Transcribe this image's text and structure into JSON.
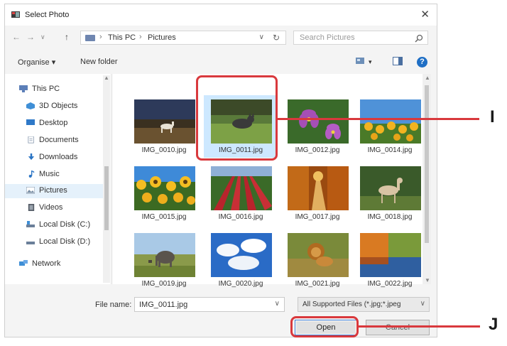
{
  "window": {
    "title": "Select Photo",
    "close_glyph": "✕"
  },
  "nav": {
    "back_glyph": "←",
    "forward_glyph": "→",
    "up_glyph": "↑",
    "address_segments": [
      "This PC",
      "Pictures"
    ],
    "separator_glyph": "›",
    "dropdown_glyph": "∨",
    "refresh_glyph": "↻",
    "search_placeholder": "Search Pictures",
    "search_glyph": "⌕"
  },
  "toolbar": {
    "organise_label": "Organise ▾",
    "new_folder_label": "New folder",
    "view_dd_glyph": "▾",
    "help_glyph": "?"
  },
  "sidebar": {
    "items": [
      {
        "label": "This PC",
        "icon": "pc-icon",
        "color": "#5c7fb8"
      },
      {
        "label": "3D Objects",
        "icon": "cube-icon",
        "color": "#3f8fd6"
      },
      {
        "label": "Desktop",
        "icon": "desktop-icon",
        "color": "#2f79c8"
      },
      {
        "label": "Documents",
        "icon": "document-icon",
        "color": "#8a9bb0"
      },
      {
        "label": "Downloads",
        "icon": "download-icon",
        "color": "#2a74c4"
      },
      {
        "label": "Music",
        "icon": "music-icon",
        "color": "#2a74c4"
      },
      {
        "label": "Pictures",
        "icon": "pictures-icon",
        "color": "#7a8fa6"
      },
      {
        "label": "Videos",
        "icon": "video-icon",
        "color": "#555c66"
      },
      {
        "label": "Local Disk (C:)",
        "icon": "disk-icon",
        "color": "#6b7f99"
      },
      {
        "label": "Local Disk (D:)",
        "icon": "disk-icon",
        "color": "#6b7f99"
      },
      {
        "label": "Network",
        "icon": "network-icon",
        "color": "#3f8fd6"
      }
    ],
    "selected_label": "Pictures"
  },
  "files": [
    {
      "name": "IMG_0010.jpg",
      "subject": "horse-on-dark-field",
      "selected": false
    },
    {
      "name": "IMG_0011.jpg",
      "subject": "cat-on-grass",
      "selected": true
    },
    {
      "name": "IMG_0012.jpg",
      "subject": "purple-flowers",
      "selected": false
    },
    {
      "name": "IMG_0014.jpg",
      "subject": "sunflowers-blue-sky",
      "selected": false
    },
    {
      "name": "IMG_0015.jpg",
      "subject": "sunflower-field",
      "selected": false
    },
    {
      "name": "IMG_0016.jpg",
      "subject": "tulip-rows",
      "selected": false
    },
    {
      "name": "IMG_0017.jpg",
      "subject": "autumn-path",
      "selected": false
    },
    {
      "name": "IMG_0018.jpg",
      "subject": "deer",
      "selected": false
    },
    {
      "name": "IMG_0019.jpg",
      "subject": "elephant-savanna",
      "selected": false
    },
    {
      "name": "IMG_0020.jpg",
      "subject": "clouds-sky",
      "selected": false
    },
    {
      "name": "IMG_0021.jpg",
      "subject": "lion",
      "selected": false
    },
    {
      "name": "IMG_0022.jpg",
      "subject": "autumn-lake",
      "selected": false
    }
  ],
  "bottom": {
    "filename_label": "File name:",
    "filename_value": "IMG_0011.jpg",
    "filetype_value": "All Supported Files (*.jpg;*.jpeg",
    "dropdown_glyph": "∨",
    "open_label": "Open",
    "cancel_label": "Cancel"
  },
  "annotations": {
    "label_i": "I",
    "label_j": "J",
    "color": "#d9393d"
  }
}
